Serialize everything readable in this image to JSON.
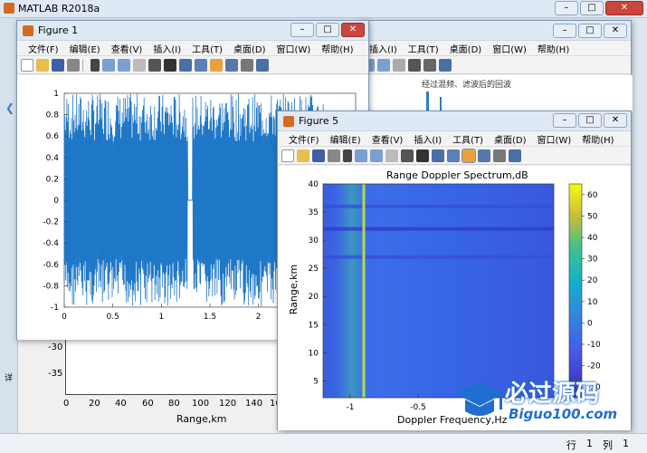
{
  "app": {
    "title": "MATLAB R2018a"
  },
  "status": {
    "row_label": "行",
    "row_value": "1",
    "col_label": "列",
    "col_value": "1"
  },
  "menu": [
    "文件(F)",
    "编辑(E)",
    "查看(V)",
    "插入(I)",
    "工具(T)",
    "桌面(D)",
    "窗口(W)",
    "帮助(H)"
  ],
  "bg_figure": {
    "title": "经过混频、滤波后的回波",
    "xlabel": "Range,km",
    "yticks": [
      "-30",
      "-35"
    ],
    "xticks": [
      "0",
      "20",
      "40",
      "60",
      "80",
      "100",
      "120",
      "140",
      "160"
    ]
  },
  "fig1": {
    "title": "Figure 1",
    "xticks": [
      "0",
      "0.5",
      "1",
      "1.5",
      "2",
      "2.5"
    ],
    "yticks": [
      "1",
      "0.8",
      "0.6",
      "0.4",
      "0.2",
      "0",
      "-0.2",
      "-0.4",
      "-0.6",
      "-0.8",
      "-1"
    ]
  },
  "fig5": {
    "title": "Figure 5",
    "chart_title": "Range Doppler Spectrum,dB",
    "xlabel": "Doppler Frequency,Hz",
    "ylabel": "Range,km",
    "xticks": [
      "-1",
      "-0.5",
      "0"
    ],
    "yticks": [
      "40",
      "35",
      "30",
      "25",
      "20",
      "15",
      "10",
      "5"
    ],
    "cbar_ticks": [
      "60",
      "50",
      "40",
      "30",
      "20",
      "10",
      "0",
      "-10",
      "-20",
      "-30"
    ]
  },
  "watermark": {
    "line1": "必过源码",
    "line2": "Biguo100.com"
  },
  "chart_data": [
    {
      "type": "line",
      "title": "",
      "xlabel": "",
      "ylabel": "",
      "xlim": [
        0,
        3
      ],
      "ylim": [
        -1,
        1
      ],
      "series": [
        {
          "description_values": "dense oscillating echo signal between -1 and 1, with a gap near x=1.3"
        }
      ]
    },
    {
      "type": "heatmap",
      "title": "Range Doppler Spectrum,dB",
      "xlabel": "Doppler Frequency,Hz",
      "ylabel": "Range,km",
      "xlim": [
        -1.2,
        0.5
      ],
      "ylim": [
        2,
        40
      ],
      "colorbar_range": [
        -35,
        65
      ],
      "peak_line_x": -0.9,
      "bright_rows_y": [
        32,
        27,
        36
      ]
    }
  ]
}
